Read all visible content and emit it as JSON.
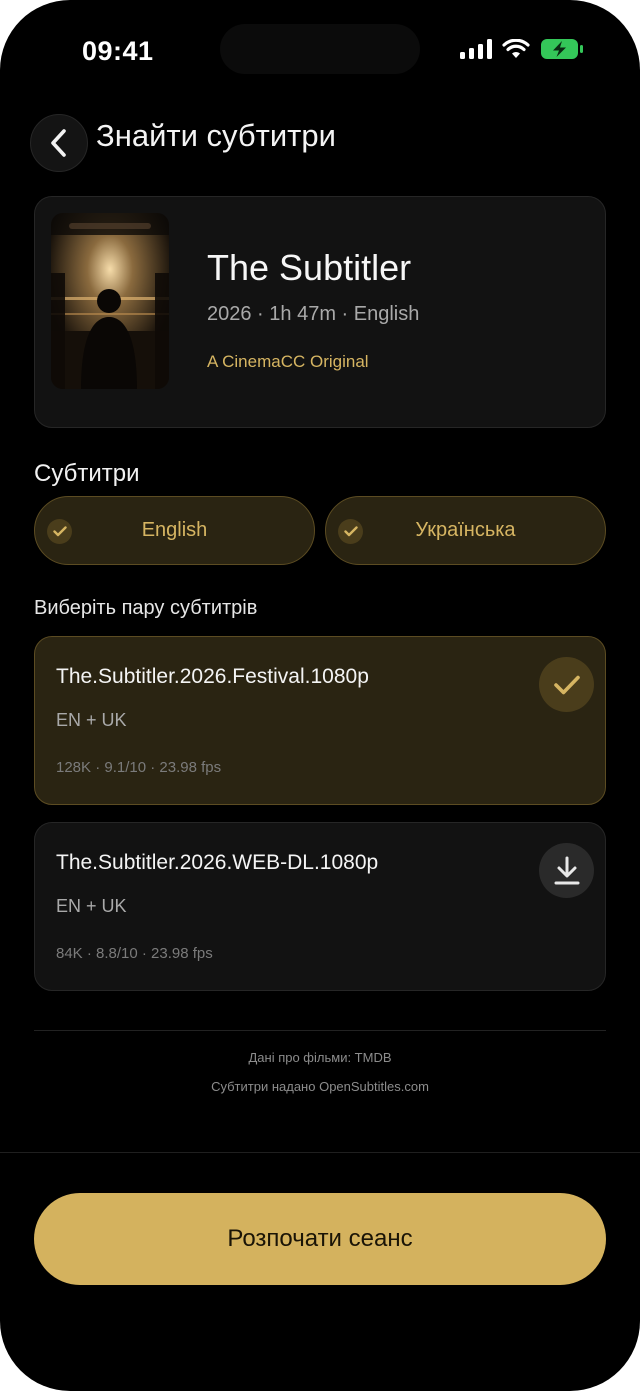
{
  "status": {
    "time": "09:41",
    "icons": [
      "signal-icon",
      "wifi-icon",
      "battery-charging-icon"
    ]
  },
  "header": {
    "back_icon": "chevron-left-icon",
    "title": "Знайти субтитри"
  },
  "movie": {
    "title": "The Subtitler",
    "meta": "2026 · 1h 47m · English",
    "tag": "A CinemaCC Original"
  },
  "subtitles": {
    "label": "Субтитри",
    "languages": [
      {
        "label": "English",
        "selected": true
      },
      {
        "label": "Українська",
        "selected": true
      }
    ],
    "pair_label": "Виберіть пару субтитрів",
    "pairs": [
      {
        "name": "The.Subtitler.2026.Festival.1080p",
        "langs": "EN + UK",
        "stats": "128K · 9.1/10 · 23.98 fps",
        "state": "selected",
        "icon": "check-icon"
      },
      {
        "name": "The.Subtitler.2026.WEB-DL.1080p",
        "langs": "EN + UK",
        "stats": "84K · 8.8/10 · 23.98 fps",
        "state": "download",
        "icon": "download-icon"
      }
    ]
  },
  "credits": {
    "line1": "Дані про фільми: TMDB",
    "line2": "Субтитри надано OpenSubtitles.com"
  },
  "cta": {
    "label": "Розпочати сеанс"
  },
  "colors": {
    "background": "#000000",
    "card": "#121212",
    "accent": "#d4b25e",
    "accent_dark": "#2a2412",
    "battery": "#34c759"
  }
}
